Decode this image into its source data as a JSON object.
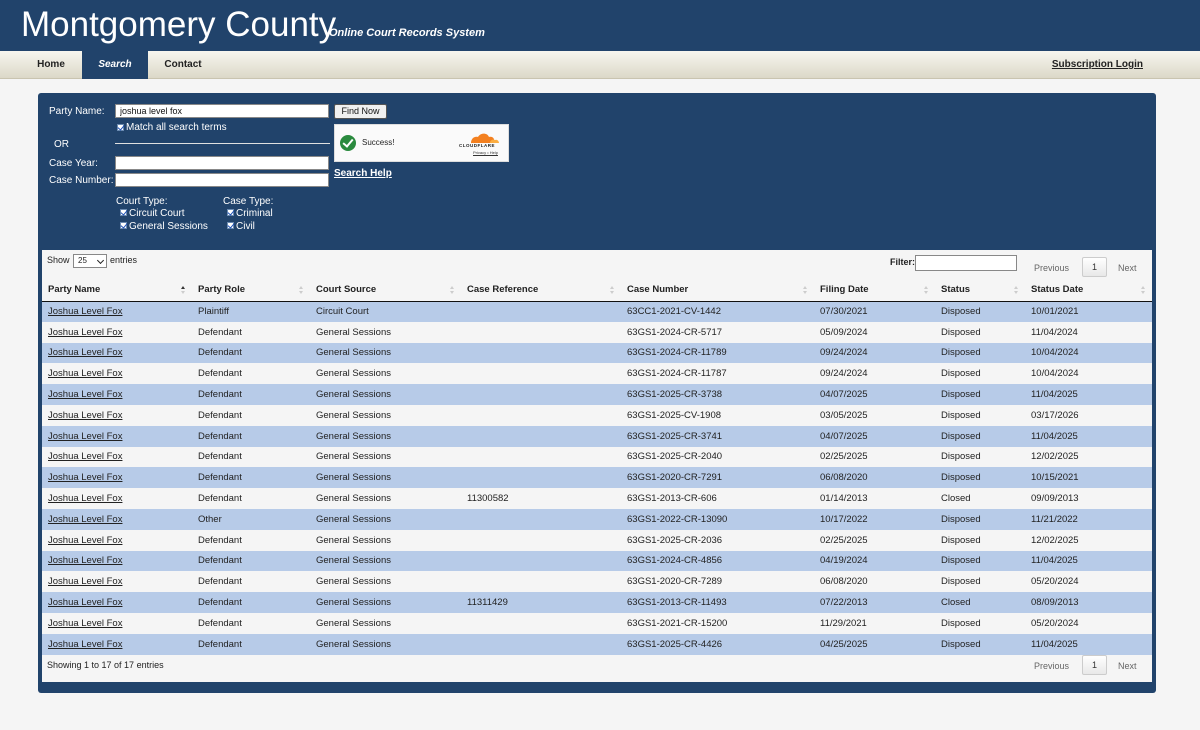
{
  "header": {
    "title": "Montgomery County",
    "subtitle": "Online Court Records System"
  },
  "nav": {
    "home": "Home",
    "search": "Search",
    "contact": "Contact",
    "login": "Subscription Login"
  },
  "search": {
    "party_name_label": "Party Name:",
    "party_name_value": "joshua level fox",
    "match_all_label": "Match all search terms",
    "or_label": "OR",
    "case_year_label": "Case Year:",
    "case_number_label": "Case Number:",
    "find_button": "Find Now",
    "captcha_text": "Success!",
    "captcha_brand": "CLOUDFLARE",
    "captcha_links": "Privacy • Help",
    "search_help": "Search Help",
    "court_type_label": "Court Type:",
    "court_types": [
      "Circuit Court",
      "General Sessions"
    ],
    "case_type_label": "Case Type:",
    "case_types": [
      "Criminal",
      "Civil"
    ]
  },
  "results": {
    "show_label": "Show",
    "show_value": "25",
    "entries_label": "entries",
    "filter_label": "Filter:",
    "previous": "Previous",
    "page": "1",
    "next": "Next",
    "summary": "Showing 1 to 17 of 17 entries",
    "columns": [
      "Party Name",
      "Party Role",
      "Court Source",
      "Case Reference",
      "Case Number",
      "Filing Date",
      "Status",
      "Status Date"
    ],
    "rows": [
      [
        "Joshua Level Fox",
        "Plaintiff",
        "Circuit Court",
        "",
        "63CC1-2021-CV-1442",
        "07/30/2021",
        "Disposed",
        "10/01/2021"
      ],
      [
        "Joshua Level Fox",
        "Defendant",
        "General Sessions",
        "",
        "63GS1-2024-CR-5717",
        "05/09/2024",
        "Disposed",
        "11/04/2024"
      ],
      [
        "Joshua Level Fox",
        "Defendant",
        "General Sessions",
        "",
        "63GS1-2024-CR-11789",
        "09/24/2024",
        "Disposed",
        "10/04/2024"
      ],
      [
        "Joshua Level Fox",
        "Defendant",
        "General Sessions",
        "",
        "63GS1-2024-CR-11787",
        "09/24/2024",
        "Disposed",
        "10/04/2024"
      ],
      [
        "Joshua Level Fox",
        "Defendant",
        "General Sessions",
        "",
        "63GS1-2025-CR-3738",
        "04/07/2025",
        "Disposed",
        "11/04/2025"
      ],
      [
        "Joshua Level Fox",
        "Defendant",
        "General Sessions",
        "",
        "63GS1-2025-CV-1908",
        "03/05/2025",
        "Disposed",
        "03/17/2026"
      ],
      [
        "Joshua Level Fox",
        "Defendant",
        "General Sessions",
        "",
        "63GS1-2025-CR-3741",
        "04/07/2025",
        "Disposed",
        "11/04/2025"
      ],
      [
        "Joshua Level Fox",
        "Defendant",
        "General Sessions",
        "",
        "63GS1-2025-CR-2040",
        "02/25/2025",
        "Disposed",
        "12/02/2025"
      ],
      [
        "Joshua Level Fox",
        "Defendant",
        "General Sessions",
        "",
        "63GS1-2020-CR-7291",
        "06/08/2020",
        "Disposed",
        "10/15/2021"
      ],
      [
        "Joshua Level Fox",
        "Defendant",
        "General Sessions",
        "11300582",
        "63GS1-2013-CR-606",
        "01/14/2013",
        "Closed",
        "09/09/2013"
      ],
      [
        "Joshua Level Fox",
        "Other",
        "General Sessions",
        "",
        "63GS1-2022-CR-13090",
        "10/17/2022",
        "Disposed",
        "11/21/2022"
      ],
      [
        "Joshua Level Fox",
        "Defendant",
        "General Sessions",
        "",
        "63GS1-2025-CR-2036",
        "02/25/2025",
        "Disposed",
        "12/02/2025"
      ],
      [
        "Joshua Level Fox",
        "Defendant",
        "General Sessions",
        "",
        "63GS1-2024-CR-4856",
        "04/19/2024",
        "Disposed",
        "11/04/2025"
      ],
      [
        "Joshua Level Fox",
        "Defendant",
        "General Sessions",
        "",
        "63GS1-2020-CR-7289",
        "06/08/2020",
        "Disposed",
        "05/20/2024"
      ],
      [
        "Joshua Level Fox",
        "Defendant",
        "General Sessions",
        "11311429",
        "63GS1-2013-CR-11493",
        "07/22/2013",
        "Closed",
        "08/09/2013"
      ],
      [
        "Joshua Level Fox",
        "Defendant",
        "General Sessions",
        "",
        "63GS1-2021-CR-15200",
        "11/29/2021",
        "Disposed",
        "05/20/2024"
      ],
      [
        "Joshua Level Fox",
        "Defendant",
        "General Sessions",
        "",
        "63GS1-2025-CR-4426",
        "04/25/2025",
        "Disposed",
        "11/04/2025"
      ]
    ]
  },
  "colors": {
    "header_bg": "#21436b",
    "row_odd": "#b7cbe8",
    "row_even": "#f5f5f5",
    "captcha_success": "#2a8a3e",
    "cloudflare_orange": "#f38020"
  }
}
